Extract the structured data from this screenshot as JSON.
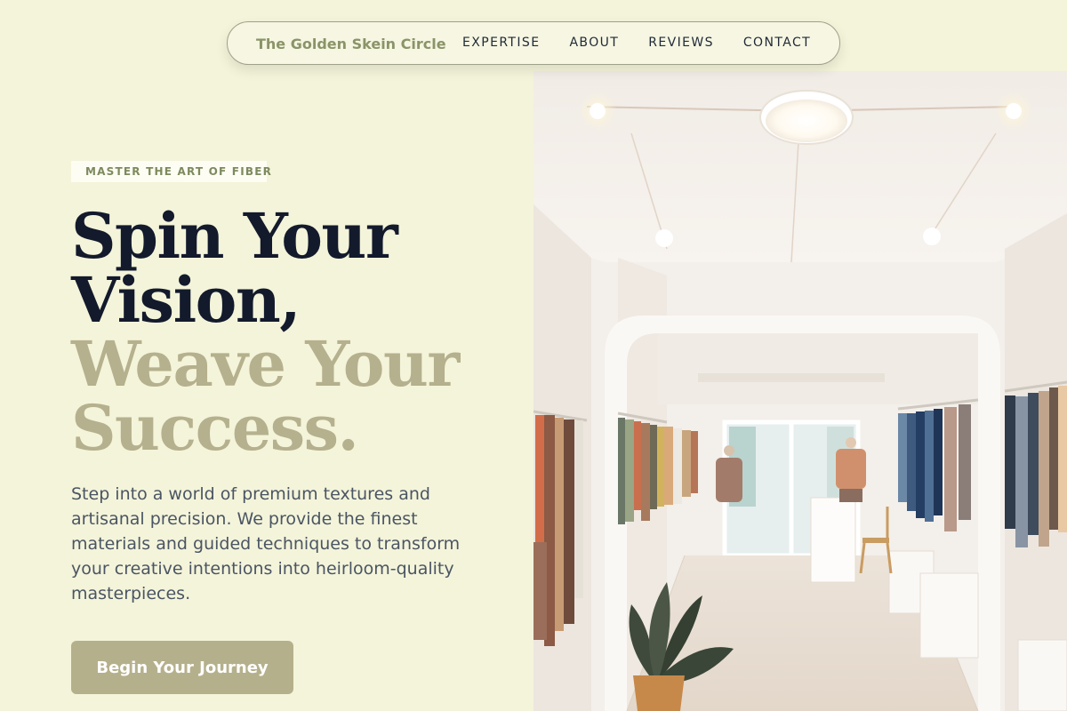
{
  "nav": {
    "brand": "The Golden Skein Circle",
    "links": [
      "EXPERTISE",
      "ABOUT",
      "REVIEWS",
      "CONTACT"
    ]
  },
  "hero": {
    "eyebrow": "MASTER THE ART OF FIBER",
    "headline_dark": [
      "Spin Your",
      "Vision,"
    ],
    "headline_gold": [
      "Weave Your",
      "Success."
    ],
    "lead": "Step into a world of premium textures and artisanal precision. We provide the finest materials and guided techniques to transform your creative intentions into heirloom-quality masterpieces.",
    "cta_label": "Begin Your Journey"
  },
  "image": {
    "subject": "boutique-interior-photo"
  },
  "colors": {
    "background": "#f4f4da",
    "brand": "#8a9468",
    "accent_gold": "#b5b08d",
    "heading_dark": "#131a2c",
    "cta": "#b5b08c"
  }
}
